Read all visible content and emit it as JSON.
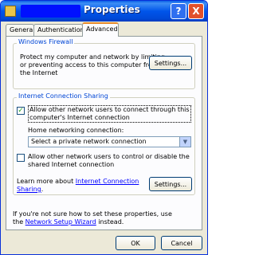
{
  "window": {
    "title": "Properties"
  },
  "titlebar_buttons": {
    "help": "?",
    "close": "X"
  },
  "tabs": [
    {
      "label": "General"
    },
    {
      "label": "Authentication"
    },
    {
      "label": "Advanced"
    }
  ],
  "firewall": {
    "legend": "Windows Firewall",
    "desc_line1": "Protect my computer and network by limiting",
    "desc_line2": "or preventing access to this computer from",
    "desc_line3": "the Internet",
    "settings_label": "Settings..."
  },
  "ics": {
    "legend": "Internet Connection Sharing",
    "allow_connect_line1": "Allow other network users to connect through this",
    "allow_connect_line2": "computer's Internet connection",
    "allow_connect_checked": true,
    "home_label": "Home networking connection:",
    "home_selected": "Select a private network connection",
    "allow_control_line1": "Allow other network users to control or disable the",
    "allow_control_line2": "shared Internet connection",
    "allow_control_checked": false,
    "learn_prefix": "Learn more about ",
    "learn_link_part1": "Internet Connection",
    "learn_link_part2": "Sharing",
    "learn_suffix": ".",
    "settings_label": "Settings..."
  },
  "footer": {
    "line1": "If you're not sure how to set these properties, use",
    "line2_prefix": "the ",
    "wizard_link": "Network Setup Wizard",
    "line2_suffix": " instead."
  },
  "buttons": {
    "ok": "OK",
    "cancel": "Cancel"
  }
}
